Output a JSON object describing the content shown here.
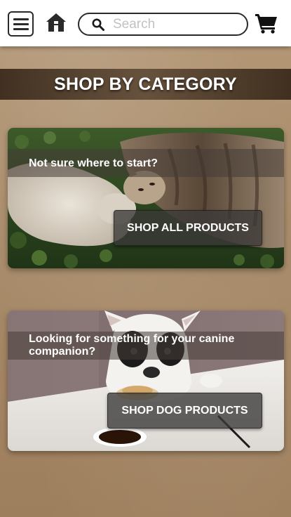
{
  "header": {
    "menu_icon": "hamburger-menu-icon",
    "home_icon": "house-icon",
    "search": {
      "placeholder": "Search",
      "value": "",
      "icon": "magnifier-icon"
    },
    "cart_icon": "shopping-cart-icon"
  },
  "main": {
    "title": "SHOP BY CATEGORY",
    "cards": [
      {
        "caption": "Not sure where to start?",
        "button_label": "SHOP ALL PRODUCTS",
        "image": "cat-and-kitten-on-grass"
      },
      {
        "caption": "Looking for something for your canine companion?",
        "button_label": "SHOP DOG PRODUCTS",
        "image": "french-bulldog-at-table-with-coffee"
      }
    ]
  },
  "colors": {
    "header_bg": "#ffffff",
    "icon_dark": "#2a2a2a",
    "page_bg": "#a78a68",
    "title_band": "#3c2a1a",
    "button_bg": "#3a3837",
    "text_light": "#ffffff"
  }
}
